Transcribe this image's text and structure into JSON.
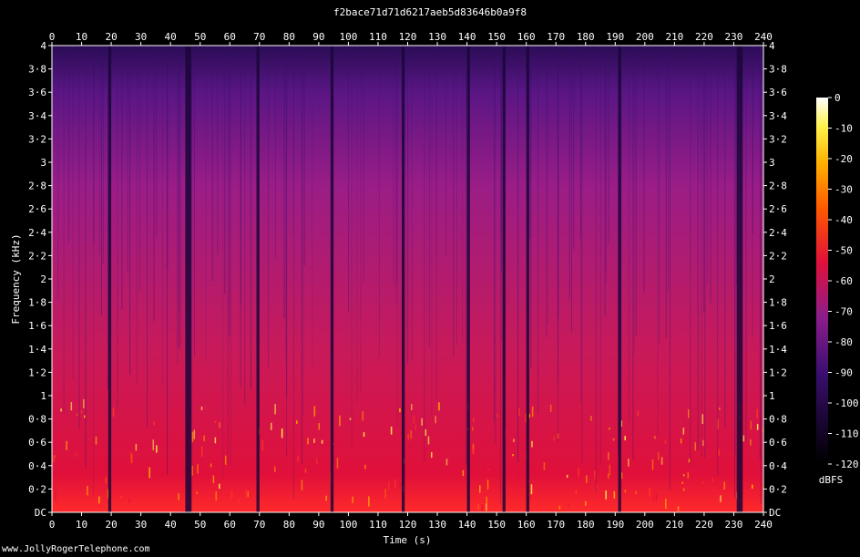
{
  "title": "f2bace71d71d6217aeb5d83646b0a9f8",
  "watermark": "www.JollyRogerTelephone.com",
  "chart_data": {
    "type": "heatmap",
    "title": "f2bace71d71d6217aeb5d83646b0a9f8",
    "xlabel": "Time (s)",
    "ylabel": "Frequency (kHz)",
    "xlim": [
      0,
      240
    ],
    "ylim": [
      0,
      4
    ],
    "x_ticks": [
      "0",
      "10",
      "20",
      "30",
      "40",
      "50",
      "60",
      "70",
      "80",
      "90",
      "100",
      "110",
      "120",
      "130",
      "140",
      "150",
      "160",
      "170",
      "180",
      "190",
      "200",
      "210",
      "220",
      "230",
      "240"
    ],
    "y_ticks": [
      "DC",
      "0·2",
      "0·4",
      "0·6",
      "0·8",
      "1",
      "1·2",
      "1·4",
      "1·6",
      "1·8",
      "2",
      "2·2",
      "2·4",
      "2·6",
      "2·8",
      "3",
      "3·2",
      "3·4",
      "3·6",
      "3·8",
      "4"
    ],
    "colorbar": {
      "label": "dBFS",
      "range": [
        -120,
        0
      ],
      "ticks": [
        "0",
        "-10",
        "-20",
        "-30",
        "-40",
        "-50",
        "-60",
        "-70",
        "-80",
        "-90",
        "-100",
        "-110",
        "-120"
      ]
    },
    "colors": {
      "background": "#000000",
      "low": "#000000",
      "mid_low": "#3b0f70",
      "mid": "#8c1d8c",
      "mid_high": "#e0103a",
      "high": "#ff9900",
      "peak": "#ffffff"
    },
    "silence_gaps_s": [
      [
        19,
        20
      ],
      [
        45,
        47
      ],
      [
        69,
        70
      ],
      [
        94,
        95
      ],
      [
        118,
        119
      ],
      [
        140,
        141
      ],
      [
        152,
        153
      ],
      [
        160,
        161
      ],
      [
        191,
        192
      ],
      [
        231,
        233
      ]
    ]
  }
}
